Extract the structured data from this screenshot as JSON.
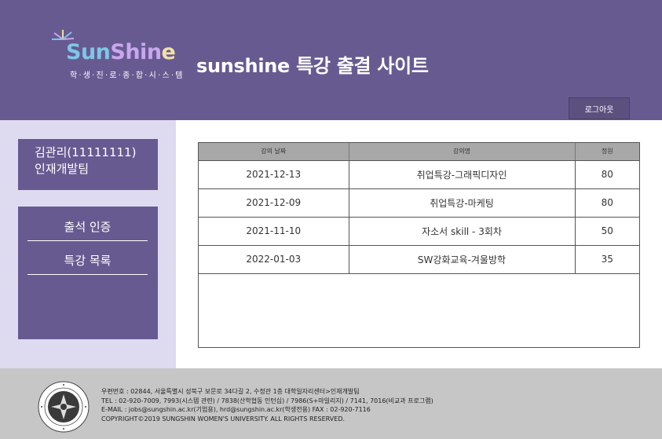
{
  "header": {
    "logo_word": [
      "Sun",
      "Shin",
      "e"
    ],
    "logo_sub": "학·생·진·로·종·합·시·스·템",
    "site_title": "sunshine 특강 출결 사이트",
    "logout_label": "로그아웃"
  },
  "sidebar": {
    "user_id_line": "김관리(11111111)",
    "user_dept_line": "인재개발팀",
    "menu": [
      {
        "label": "출석 인증"
      },
      {
        "label": "특강 목록"
      }
    ]
  },
  "table": {
    "headers": [
      "강의 날짜",
      "강의명",
      "정원"
    ],
    "rows": [
      {
        "date": "2021-12-13",
        "name": "취업특강-그래픽디자인",
        "capacity": "80"
      },
      {
        "date": "2021-12-09",
        "name": "취업특강-마케팅",
        "capacity": "80"
      },
      {
        "date": "2021-11-10",
        "name": "자소서 skill - 3회차",
        "capacity": "50"
      },
      {
        "date": "2022-01-03",
        "name": "SW강화교육-겨울방학",
        "capacity": "35"
      }
    ]
  },
  "footer": {
    "lines": [
      "우편번호 : 02844, 서울특별시 성북구 보문로 34다길 2, 수정관 1층 대학일자리센터>인재개발팀",
      "TEL : 02-920-7009, 7993(시스템 관련) / 7838(산학협동 인턴십) / 7986(S+마일리지) / 7141, 7016(비교과 프로그램)",
      "E-MAIL : jobs@sungshin.ac.kr(기업용), hrd@sungshin.ac.kr(학생전용) FAX : 02-920-7116",
      "COPYRIGHT©2019 SUNGSHIN WOMEN'S UNIVERSITY. ALL RIGHTS RESERVED."
    ],
    "seal_text": "성신여자대학교 SUNGSHIN WOMEN'S UNIVERSITY"
  },
  "colors": {
    "brand_purple": "#675a91",
    "sidebar_bg": "#dedbf0",
    "footer_bg": "#c6c6c6",
    "table_header_bg": "#a8a8a8"
  },
  "icons": {
    "logo_spark": "sparkle-icon",
    "seal": "university-seal-icon"
  }
}
